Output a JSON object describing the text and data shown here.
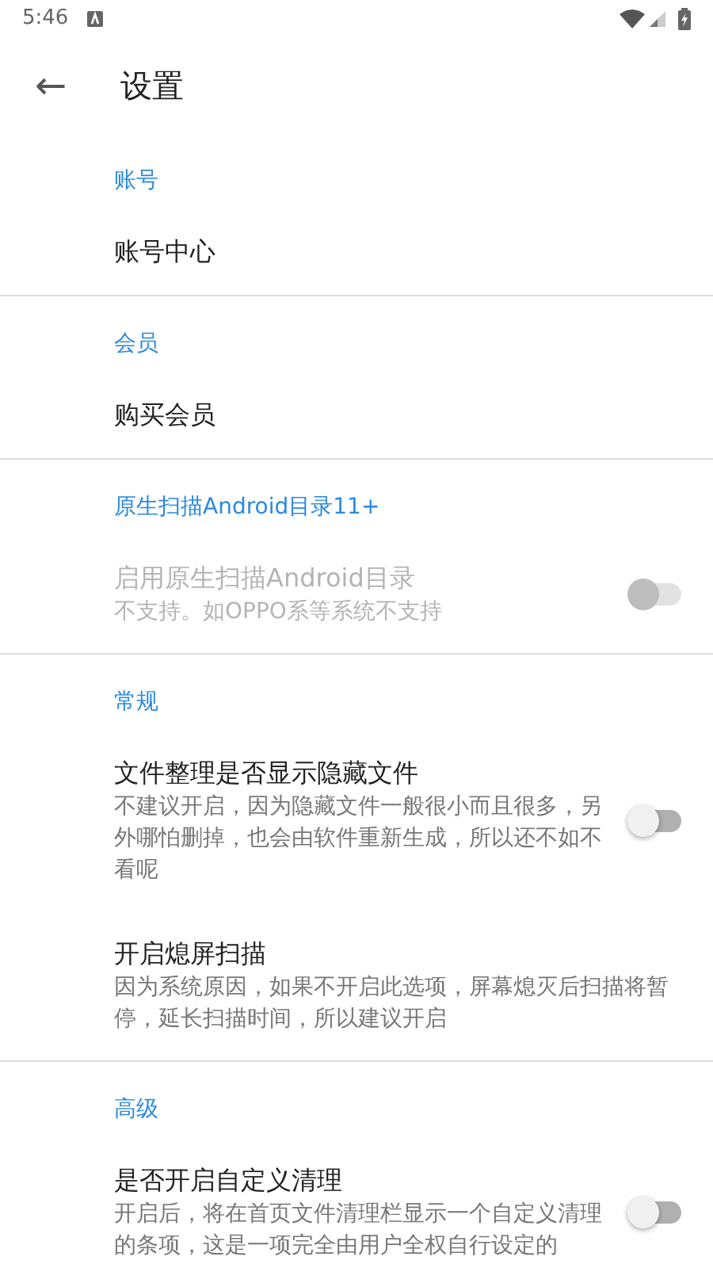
{
  "status_bar": {
    "time": "5:46"
  },
  "toolbar": {
    "back": "←",
    "title": "设置"
  },
  "sections": [
    {
      "header": "账号",
      "items": [
        {
          "title": "账号中心",
          "disabled": false
        }
      ]
    },
    {
      "header": "会员",
      "items": [
        {
          "title": "购买会员",
          "disabled": false
        }
      ]
    },
    {
      "header": "原生扫描Android目录11+",
      "items": [
        {
          "title": "启用原生扫描Android目录",
          "summary": "不支持。如OPPO系等系统不支持",
          "disabled": true,
          "switch": {
            "on": false
          }
        }
      ]
    },
    {
      "header": "常规",
      "items": [
        {
          "title": "文件整理是否显示隐藏文件",
          "summary": "不建议开启，因为隐藏文件一般很小而且很多，另外哪怕删掉，也会由软件重新生成，所以还不如不看呢",
          "disabled": false,
          "switch": {
            "on": false
          }
        },
        {
          "title": "开启熄屏扫描",
          "summary": "因为系统原因，如果不开启此选项，屏幕熄灭后扫描将暂停，延长扫描时间，所以建议开启",
          "disabled": false
        }
      ]
    },
    {
      "header": "高级",
      "items": [
        {
          "title": "是否开启自定义清理",
          "summary": "开启后，将在首页文件清理栏显示一个自定义清理的条项，这是一项完全由用户全权自行设定的",
          "disabled": false,
          "switch": {
            "on": false
          }
        }
      ]
    }
  ]
}
